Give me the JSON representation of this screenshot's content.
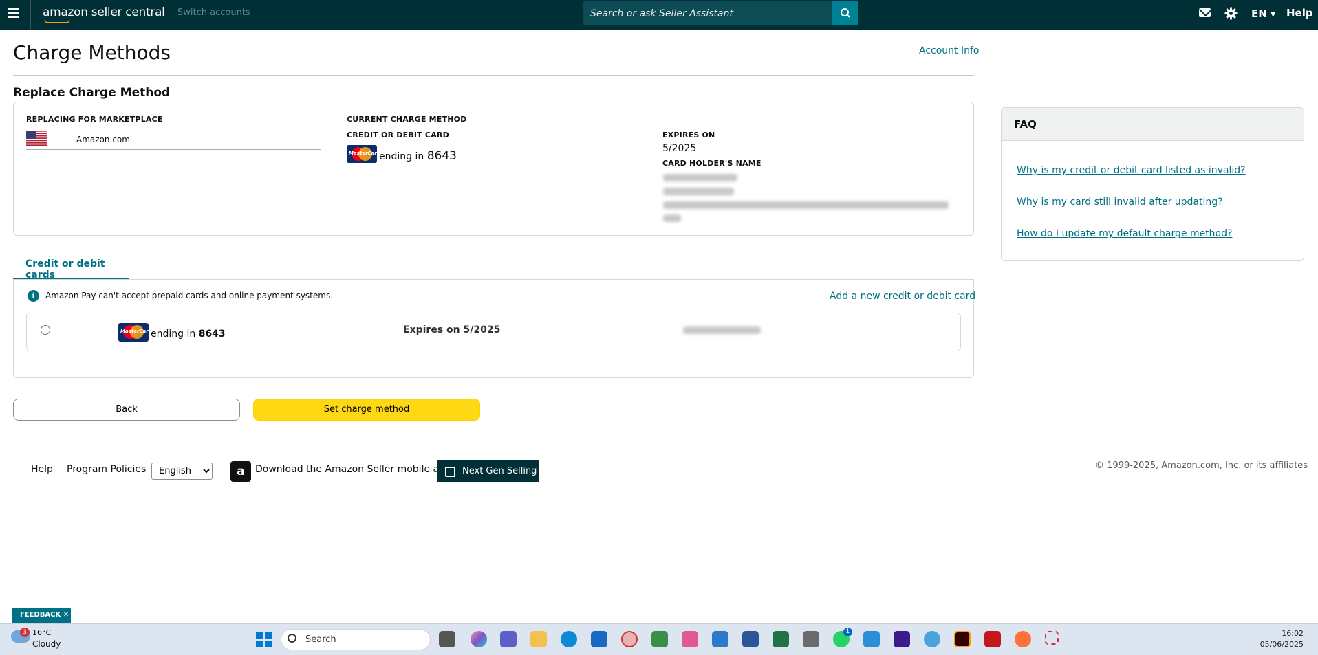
{
  "topnav": {
    "logo": "amazon seller central",
    "switch_accounts": "Switch accounts",
    "search_placeholder": "Search or ask Seller Assistant",
    "language": "EN ▾",
    "help": "Help"
  },
  "page": {
    "title": "Charge Methods",
    "account_info": "Account Info",
    "section_title": "Replace Charge Method"
  },
  "current": {
    "marketplace_label": "REPLACING FOR MARKETPLACE",
    "marketplace": "Amazon.com",
    "current_label": "CURRENT CHARGE METHOD",
    "card_type_label": "CREDIT OR DEBIT CARD",
    "ending_prefix": "ending in",
    "ending": "8643",
    "expires_label": "EXPIRES ON",
    "expires": "5/2025",
    "holder_label": "CARD HOLDER'S NAME"
  },
  "cards": {
    "tab": "Credit or debit cards",
    "info": "Amazon Pay can't accept prepaid cards and online payment systems.",
    "add_card": "Add a new credit or debit card",
    "items": [
      {
        "ending_prefix": "ending in",
        "ending": "8643",
        "expires_prefix": "Expires on",
        "expires": "5/2025"
      }
    ]
  },
  "buttons": {
    "back": "Back",
    "set": "Set charge method"
  },
  "faq": {
    "title": "FAQ",
    "links": [
      "Why is my credit or debit card listed as invalid?",
      "Why is my card still invalid after updating?",
      "How do I update my default charge method?"
    ]
  },
  "footer": {
    "help": "Help",
    "policies": "Program Policies",
    "language": "English",
    "app_text": "Download the Amazon Seller mobile app",
    "next_gen": "Next Gen Selling",
    "copyright": "© 1999-2025, Amazon.com, Inc. or its affiliates"
  },
  "feedback": "FEEDBACK ✕",
  "taskbar": {
    "weather_badge": "3",
    "temp": "16°C",
    "condition": "Cloudy",
    "search": "Search",
    "whatsapp_badge": "1",
    "time": "16:02",
    "date": "05/06/2025"
  },
  "colors": {
    "nav_bg": "#002f36",
    "link": "#007185",
    "primary_button": "#ffd814"
  }
}
